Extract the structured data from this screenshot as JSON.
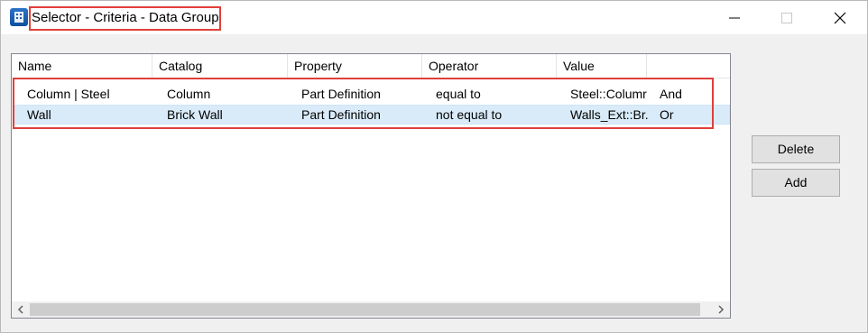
{
  "window": {
    "title": "Selector - Criteria - Data Group"
  },
  "table": {
    "columns": [
      "Name",
      "Catalog",
      "Property",
      "Operator",
      "Value",
      ""
    ],
    "rows": [
      {
        "name": "Column | Steel",
        "catalog": "Column",
        "property": "Part Definition",
        "operator": "equal to",
        "value": "Steel::Columr",
        "logic": "And"
      },
      {
        "name": "Wall",
        "catalog": "Brick Wall",
        "property": "Part Definition",
        "operator": "not equal to",
        "value": "Walls_Ext::Br.",
        "logic": "Or"
      }
    ],
    "selected_row": 1
  },
  "buttons": {
    "delete": "Delete",
    "add": "Add"
  },
  "icons": {
    "app": "app-icon",
    "minimize": "minimize-icon",
    "maximize": "maximize-icon",
    "close": "close-icon",
    "scroll_left": "chevron-left-icon",
    "scroll_right": "chevron-right-icon"
  },
  "colors": {
    "highlight_border": "#e0403a",
    "selected_row": "#d9ebf9"
  }
}
